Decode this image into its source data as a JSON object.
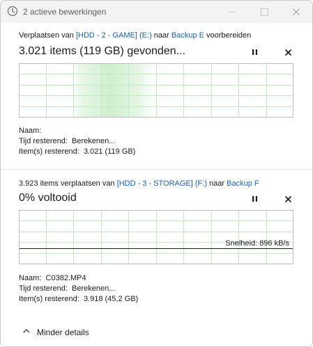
{
  "window": {
    "title": "2 actieve bewerkingen",
    "icon": "clock-icon"
  },
  "operations": [
    {
      "line_prefix": "Verplaatsen van ",
      "source": "[HDD - 2 - GAME] (E:)",
      "line_mid": " naar ",
      "destination": "Backup E",
      "line_suffix": " voorbereiden",
      "status": "3.021 items (119 GB) gevonden...",
      "naam_label": "Naam:",
      "naam_value": "",
      "tijd_label": "Tijd resterend:",
      "tijd_value": "Berekenen...",
      "items_label": "Item(s) resterend:",
      "items_value": "3.021 (119 GB)"
    },
    {
      "line_prefix": "3.923 items verplaatsen van ",
      "source": "[HDD - 3 - STORAGE] (F:)",
      "line_mid": " naar ",
      "destination": "Backup F",
      "line_suffix": "",
      "status": "0% voltooid",
      "progress": 0,
      "speed": "Snelheid: 896 kB/s",
      "naam_label": "Naam:",
      "naam_value": "C0382.MP4",
      "tijd_label": "Tijd resterend:",
      "tijd_value": "Berekenen...",
      "items_label": "Item(s) resterend:",
      "items_value": "3.918 (45,2 GB)"
    }
  ],
  "footer": {
    "label": "Minder details"
  },
  "colors": {
    "accent_green": "#7fd67f",
    "link_blue": "#1a5fb4",
    "grid_green": "#bfe6bf"
  }
}
